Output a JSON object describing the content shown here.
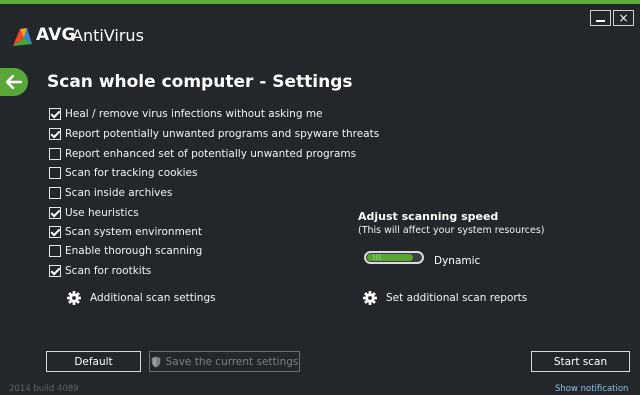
{
  "app": {
    "brand": "AVG",
    "product": "AntiVirus",
    "accent_color": "#5fae3a",
    "window_controls": {
      "minimize_icon": "minimize-icon",
      "close_label": "×"
    }
  },
  "header": {
    "back_icon": "arrow-left-icon",
    "title": "Scan whole computer - Settings"
  },
  "options": [
    {
      "label": "Heal / remove virus infections without asking me",
      "checked": true
    },
    {
      "label": "Report potentially unwanted programs and spyware threats",
      "checked": true
    },
    {
      "label": "Report enhanced set of potentially unwanted programs",
      "checked": false
    },
    {
      "label": "Scan for tracking cookies",
      "checked": false
    },
    {
      "label": "Scan inside archives",
      "checked": false
    },
    {
      "label": "Use heuristics",
      "checked": true
    },
    {
      "label": "Scan system environment",
      "checked": true
    },
    {
      "label": "Enable thorough scanning",
      "checked": false
    },
    {
      "label": "Scan for rootkits",
      "checked": true
    }
  ],
  "links": {
    "additional_settings": "Additional scan settings",
    "additional_reports": "Set additional scan reports"
  },
  "speed": {
    "title": "Adjust scanning speed",
    "subtitle": "(This will affect your system resources)",
    "value_label": "Dynamic",
    "level": 0.85
  },
  "buttons": {
    "default": "Default",
    "save": "Save the current settings",
    "start": "Start scan"
  },
  "footer": {
    "version": "2014  build 4089",
    "notification": "Show notification"
  }
}
